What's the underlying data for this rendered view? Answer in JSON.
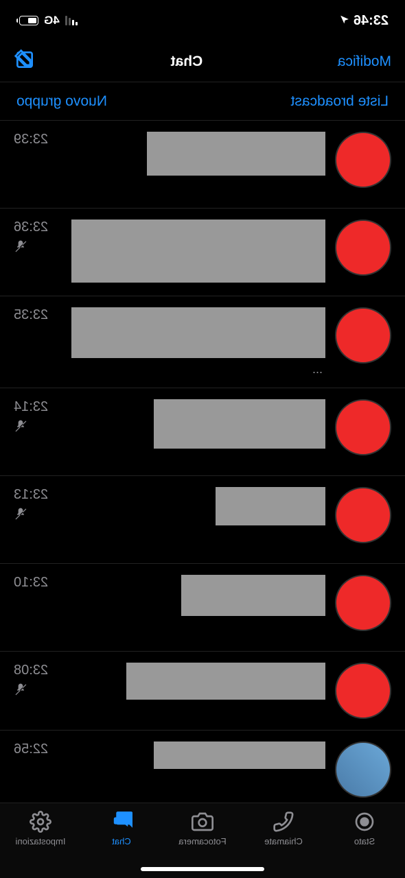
{
  "status": {
    "time": "23:46",
    "network": "4G"
  },
  "header": {
    "edit": "Modifica",
    "title": "Chat"
  },
  "actions": {
    "broadcast": "Liste broadcast",
    "newgroup": "Nuovo gruppo"
  },
  "chats": [
    {
      "time": "23:39",
      "muted": false
    },
    {
      "time": "23:36",
      "muted": true
    },
    {
      "time": "23:35",
      "muted": false
    },
    {
      "time": "23:14",
      "muted": true
    },
    {
      "time": "23:13",
      "muted": true
    },
    {
      "time": "23:10",
      "muted": false
    },
    {
      "time": "23:08",
      "muted": true
    },
    {
      "time": "22:56",
      "muted": false
    }
  ],
  "tabs": {
    "status": "Stato",
    "calls": "Chiamate",
    "camera": "Fotocamera",
    "chat": "Chat",
    "settings": "Impostazioni"
  }
}
